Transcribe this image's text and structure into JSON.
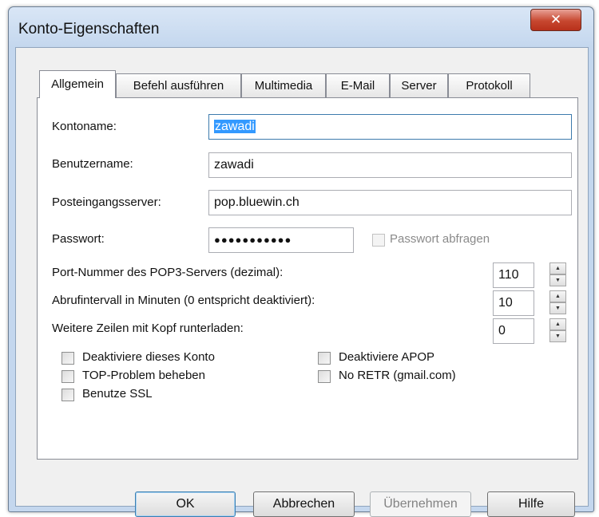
{
  "window": {
    "title": "Konto-Eigenschaften",
    "close_symbol": "✕"
  },
  "tabs": [
    "Allgemein",
    "Befehl ausführen",
    "Multimedia",
    "E-Mail",
    "Server",
    "Protokoll"
  ],
  "active_tab": "Allgemein",
  "fields": {
    "account_name": {
      "label": "Kontoname:",
      "value": "zawadi"
    },
    "username": {
      "label": "Benutzername:",
      "value": "zawadi"
    },
    "incoming_server": {
      "label": "Posteingangsserver:",
      "value": "pop.bluewin.ch"
    },
    "password": {
      "label": "Passwort:",
      "value": "●●●●●●●●●●●",
      "ask_label": "Passwort abfragen"
    }
  },
  "spinners": {
    "port": {
      "label": "Port-Nummer des POP3-Servers (dezimal):",
      "value": "110"
    },
    "interval": {
      "label": "Abrufintervall in Minuten (0 entspricht deaktiviert):",
      "value": "10"
    },
    "header_lines": {
      "label": "Weitere Zeilen mit Kopf runterladen:",
      "value": "0"
    }
  },
  "checkboxes": {
    "disable_account": "Deaktiviere dieses Konto",
    "top_fix": "TOP-Problem beheben",
    "use_ssl": "Benutze SSL",
    "disable_apop": "Deaktiviere APOP",
    "no_retr": "No RETR (gmail.com)"
  },
  "spin_arrows": {
    "up": "▲",
    "down": "▼"
  },
  "buttons": {
    "ok": "OK",
    "cancel": "Abbrechen",
    "apply": "Übernehmen",
    "help": "Hilfe"
  }
}
